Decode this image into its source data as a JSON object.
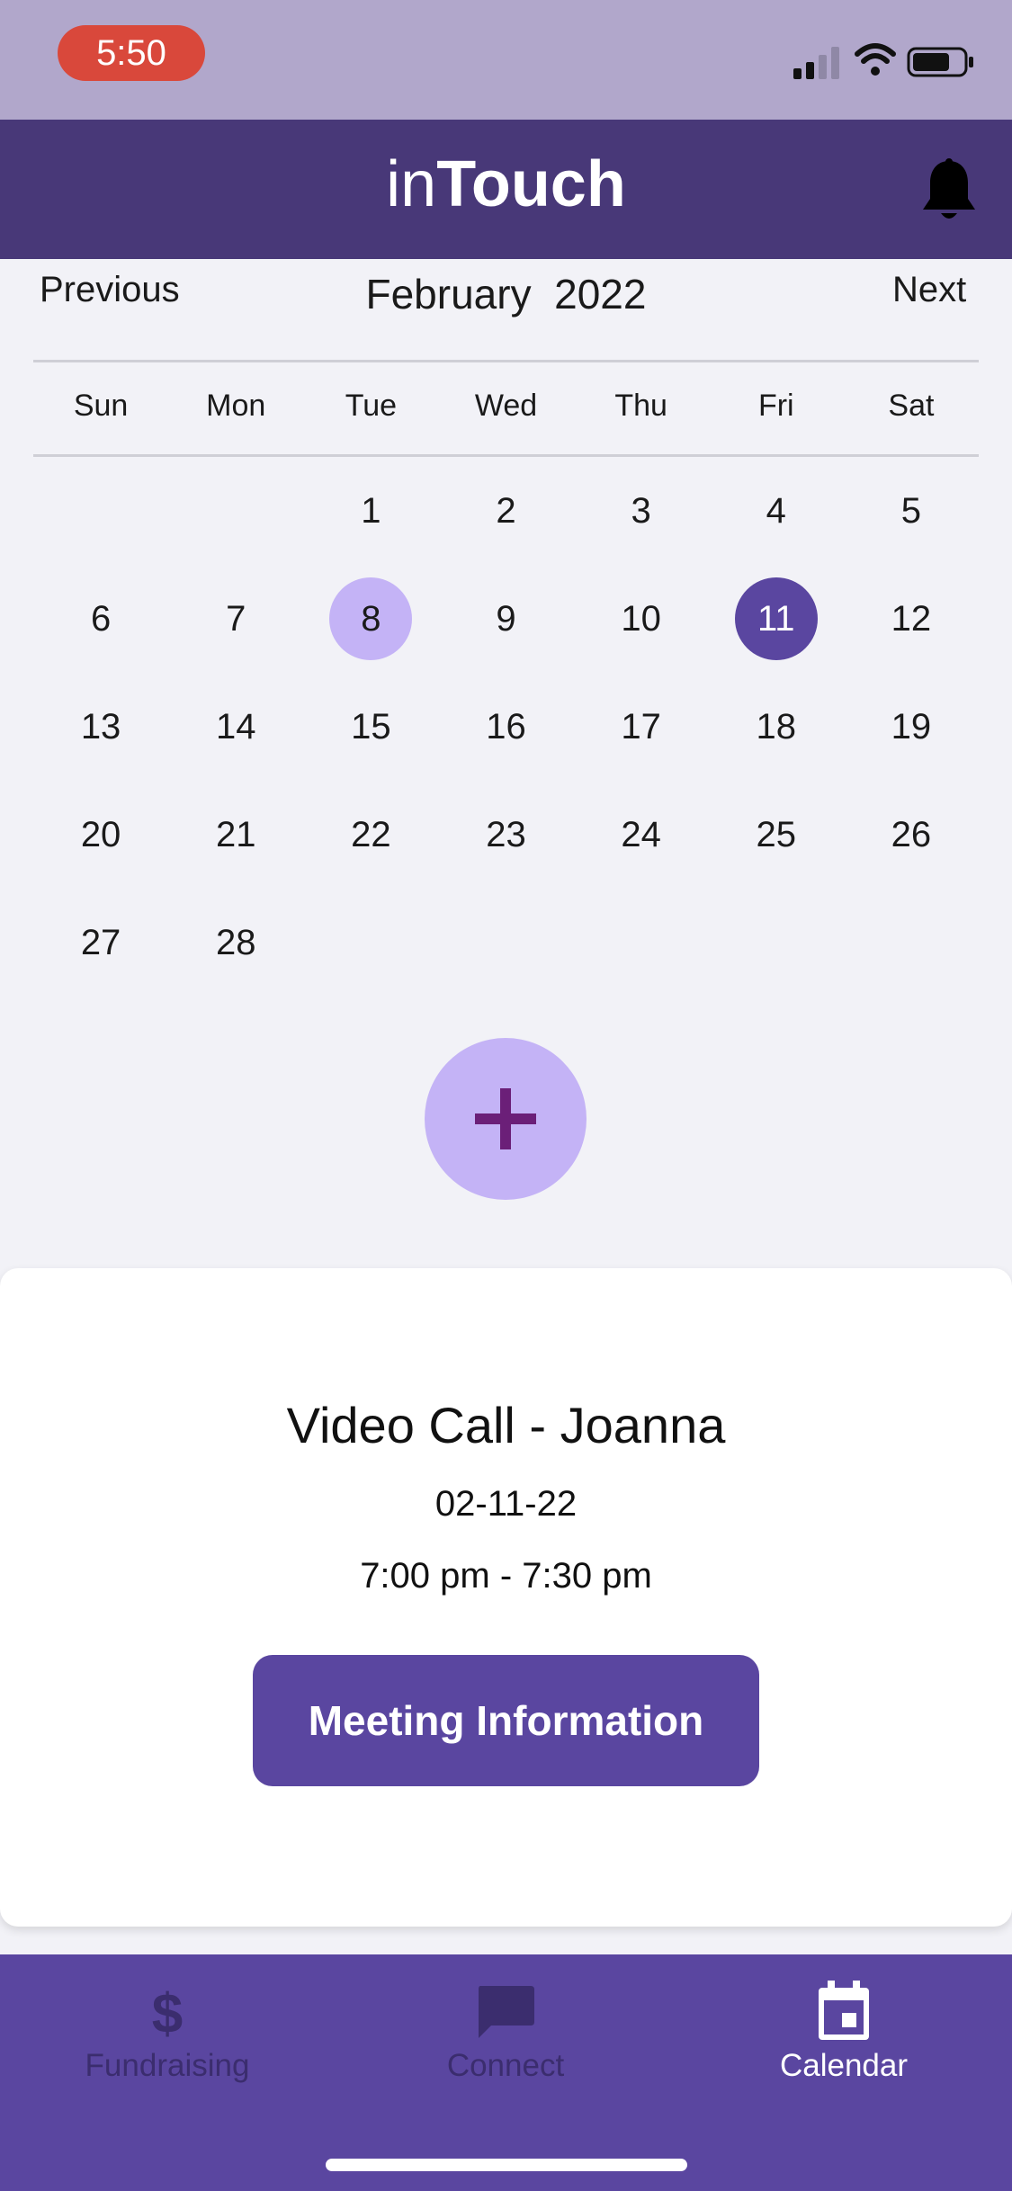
{
  "status_bar": {
    "time": "5:50"
  },
  "header": {
    "title_light": "in",
    "title_bold": "Touch"
  },
  "calendar": {
    "prev_label": "Previous",
    "next_label": "Next",
    "month": "February",
    "year": "2022",
    "weekdays": [
      "Sun",
      "Mon",
      "Tue",
      "Wed",
      "Thu",
      "Fri",
      "Sat"
    ],
    "leading_blanks": 2,
    "days": [
      "1",
      "2",
      "3",
      "4",
      "5",
      "6",
      "7",
      "8",
      "9",
      "10",
      "11",
      "12",
      "13",
      "14",
      "15",
      "16",
      "17",
      "18",
      "19",
      "20",
      "21",
      "22",
      "23",
      "24",
      "25",
      "26",
      "27",
      "28"
    ],
    "today": "8",
    "selected": "11"
  },
  "add_button": {
    "icon": "plus-icon"
  },
  "event": {
    "title": "Video Call - Joanna",
    "date": "02-11-22",
    "time": "7:00 pm - 7:30 pm",
    "button_label": "Meeting Information"
  },
  "tabs": [
    {
      "label": "Fundraising",
      "icon": "dollar-icon",
      "active": false
    },
    {
      "label": "Connect",
      "icon": "chat-icon",
      "active": false
    },
    {
      "label": "Calendar",
      "icon": "calendar-icon",
      "active": true
    }
  ],
  "colors": {
    "header": "#483878",
    "status_bar": "#b1a7cb",
    "accent": "#5a46a0",
    "accent_light": "#c4b3f6",
    "tab_inactive": "#3b2d6e",
    "record_pill": "#d9483b"
  }
}
